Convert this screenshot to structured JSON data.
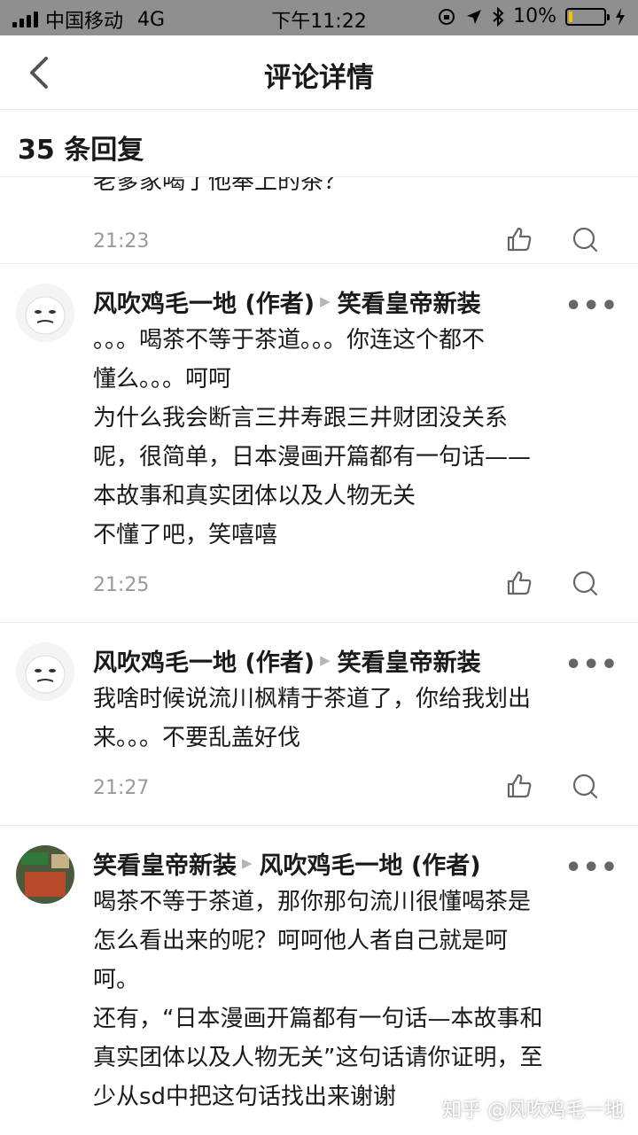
{
  "status_bar": {
    "carrier": "中国移动",
    "network": "4G",
    "time": "下午11:22",
    "battery": "10%",
    "battery_level": 0.1
  },
  "nav": {
    "title": "评论详情"
  },
  "reply_count": "35 条回复",
  "partial_comment": {
    "cut_text": "老爹家喝了他奉上的茶？",
    "time": "21:23"
  },
  "comments": [
    {
      "author": "风吹鸡毛一地 (作者)",
      "reply_to": "笑看皇帝新装",
      "lines": [
        "。。。喝茶不等于茶道。。。你连这个都不",
        "懂么。。。呵呵",
        "为什么我会断言三井寿跟三井财团没关系",
        "呢，很简单，日本漫画开篇都有一句话——",
        "本故事和真实团体以及人物无关",
        "不懂了吧，笑嘻嘻"
      ],
      "time": "21:25"
    },
    {
      "author": "风吹鸡毛一地 (作者)",
      "reply_to": "笑看皇帝新装",
      "lines": [
        "我啥时候说流川枫精于茶道了，你给我划出",
        "来。。。不要乱盖好伐"
      ],
      "time": "21:27"
    },
    {
      "author": "笑看皇帝新装",
      "reply_to": "风吹鸡毛一地 (作者)",
      "lines": [
        "喝茶不等于茶道，那你那句流川很懂喝茶是",
        "怎么看出来的呢？呵呵他人者自己就是呵",
        "呵。",
        "还有，“日本漫画开篇都有一句话—本故事和",
        "真实团体以及人物无关”这句话请你证明，至",
        "少从sd中把这句话找出来谢谢"
      ]
    }
  ],
  "watermark": "知乎 @风吹鸡毛一地",
  "more_label": "•••",
  "icons": {
    "like": "thumbs-up-icon",
    "reply": "speech-bubble-icon",
    "back": "chevron-left-icon",
    "more": "more-dots-icon"
  }
}
